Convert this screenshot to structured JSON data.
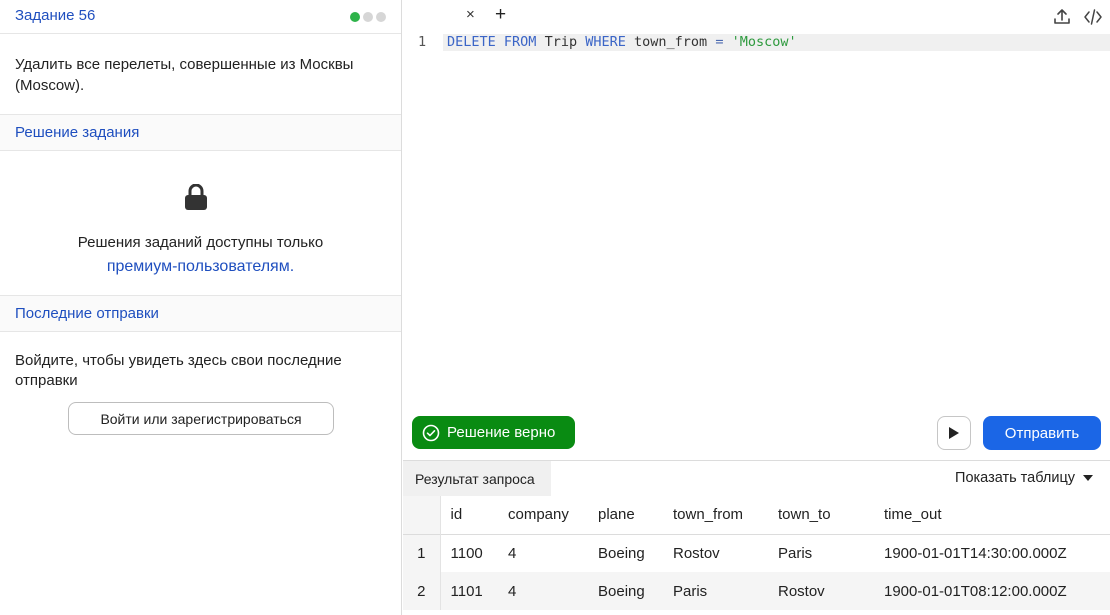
{
  "task": {
    "title": "Задание 56",
    "description": "Удалить все перелеты, совершенные из Москвы (Moscow).",
    "progress_dots": [
      "#2eb34a",
      "#d6d6d6",
      "#d6d6d6"
    ]
  },
  "solution": {
    "heading": "Решение задания",
    "locked_text": "Решения заданий доступны только",
    "premium_link": "премиум-пользователям."
  },
  "submissions": {
    "heading": "Последние отправки",
    "login_text": "Войдите, чтобы увидеть здесь свои последние отправки",
    "login_button": "Войти или зарегистрироваться"
  },
  "editor": {
    "close_tab": "×",
    "add_tab": "+",
    "line_number": "1",
    "code": {
      "kw1": "DELETE",
      "kw2": "FROM",
      "table": "Trip",
      "kw3": "WHERE",
      "column": "town_from",
      "op": "=",
      "value": "'Moscow'"
    }
  },
  "status": {
    "success_label": "Решение верно",
    "success_color": "#098b12"
  },
  "actions": {
    "submit_label": "Отправить",
    "submit_color": "#1b66e6"
  },
  "result": {
    "tab_label": "Результат запроса",
    "show_table_label": "Показать таблицу",
    "columns": [
      "id",
      "company",
      "plane",
      "town_from",
      "town_to",
      "time_out"
    ],
    "rows": [
      {
        "n": "1",
        "id": "1100",
        "company": "4",
        "plane": "Boeing",
        "town_from": "Rostov",
        "town_to": "Paris",
        "time_out": "1900-01-01T14:30:00.000Z"
      },
      {
        "n": "2",
        "id": "1101",
        "company": "4",
        "plane": "Boeing",
        "town_from": "Paris",
        "town_to": "Rostov",
        "time_out": "1900-01-01T08:12:00.000Z"
      }
    ]
  }
}
